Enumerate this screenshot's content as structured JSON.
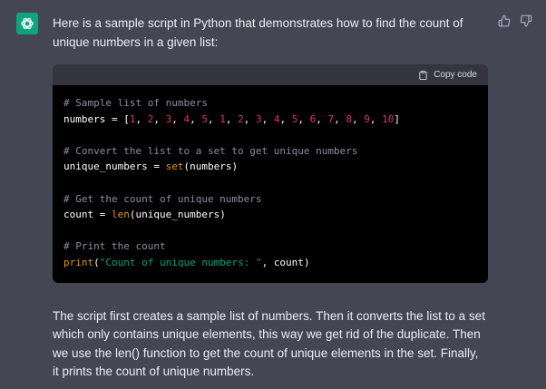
{
  "message": {
    "intro": "Here is a sample script in Python that demonstrates how to find the count of unique numbers in a given list:",
    "outro": "The script first creates a sample list of numbers. Then it converts the list to a set which only contains unique elements, this way we get rid of the duplicate. Then we use the len() function to get the count of unique elements in the set. Finally, it prints the count of unique numbers."
  },
  "code": {
    "copy_label": "Copy code",
    "comment1": "# Sample list of numbers",
    "line1_var": "numbers",
    "line1_nums": [
      "1",
      "2",
      "3",
      "4",
      "5",
      "1",
      "2",
      "3",
      "4",
      "5",
      "6",
      "7",
      "8",
      "9",
      "10"
    ],
    "comment2": "# Convert the list to a set to get unique numbers",
    "line2_var": "unique_numbers",
    "line2_fn": "set",
    "line2_arg": "numbers",
    "comment3": "# Get the count of unique numbers",
    "line3_var": "count",
    "line3_fn": "len",
    "line3_arg": "unique_numbers",
    "comment4": "# Print the count",
    "line4_fn": "print",
    "line4_str": "\"Count of unique numbers: \"",
    "line4_arg": "count"
  },
  "icons": {
    "avatar": "openai-logo-icon",
    "thumbs_up": "thumbs-up-icon",
    "thumbs_down": "thumbs-down-icon",
    "clipboard": "clipboard-icon"
  },
  "colors": {
    "background": "#444654",
    "avatar": "#10a37f",
    "code_bg": "#000000",
    "number": "#df3079",
    "function": "#e9950c",
    "string": "#00a67d",
    "comment": "#8e8ea0"
  }
}
